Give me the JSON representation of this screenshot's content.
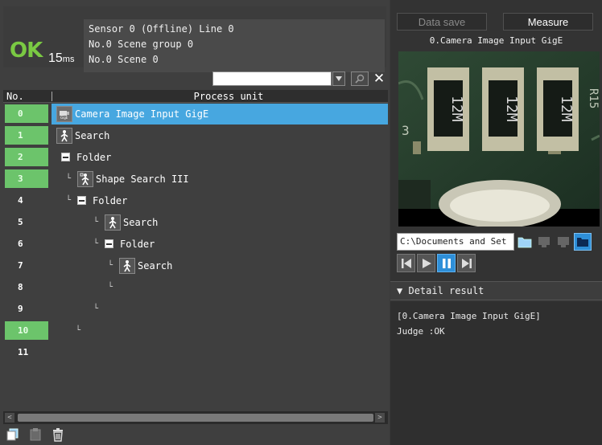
{
  "status": {
    "judge": "OK",
    "time_value": "15",
    "time_unit": "ms",
    "line1": "Sensor 0 (Offline) Line 0",
    "line2": "No.0 Scene group 0",
    "line3": "No.0 Scene 0",
    "judge_color": "#7ac943"
  },
  "search": {
    "value": "",
    "placeholder": ""
  },
  "table": {
    "col_no": "No.",
    "col_process": "Process unit",
    "rows": [
      {
        "no": "0",
        "label": "Camera Image Input GigE",
        "icon": "gige-camera-icon",
        "selected": true,
        "green": true
      },
      {
        "no": "1",
        "label": "Search",
        "icon": "search-unit-icon",
        "selected": false,
        "green": true
      },
      {
        "no": "2",
        "label": "Folder",
        "icon": "folder-collapse-icon",
        "selected": false,
        "green": true
      },
      {
        "no": "3",
        "label": "Shape Search III",
        "icon": "shape-search-icon",
        "selected": false,
        "green": true
      },
      {
        "no": "4",
        "label": "Folder",
        "icon": "folder-collapse-icon",
        "selected": false,
        "green": false
      },
      {
        "no": "5",
        "label": "Search",
        "icon": "search-unit-icon",
        "selected": false,
        "green": false
      },
      {
        "no": "6",
        "label": "Folder",
        "icon": "folder-collapse-icon",
        "selected": false,
        "green": false
      },
      {
        "no": "7",
        "label": "Search",
        "icon": "search-unit-icon",
        "selected": false,
        "green": false
      },
      {
        "no": "8",
        "label": "",
        "icon": "",
        "selected": false,
        "green": false
      },
      {
        "no": "9",
        "label": "",
        "icon": "",
        "selected": false,
        "green": false
      },
      {
        "no": "10",
        "label": "",
        "icon": "",
        "selected": false,
        "green": true
      },
      {
        "no": "11",
        "label": "",
        "icon": "",
        "selected": false,
        "green": false
      }
    ]
  },
  "toolbar": {
    "data_save_label": "Data save",
    "measure_label": "Measure"
  },
  "image": {
    "title": "0.Camera Image Input GigE",
    "resistor_label": "12M",
    "board_label_left": "3",
    "board_label_right": "R15"
  },
  "path": {
    "value": "C:\\Documents and Set"
  },
  "detail": {
    "header": "Detail result",
    "line1": "[0.Camera Image Input GigE]",
    "line2": "Judge :OK"
  },
  "colors": {
    "selection": "#47a7e0",
    "green_row": "#6cc46b",
    "play_active": "#2e8fd8"
  }
}
